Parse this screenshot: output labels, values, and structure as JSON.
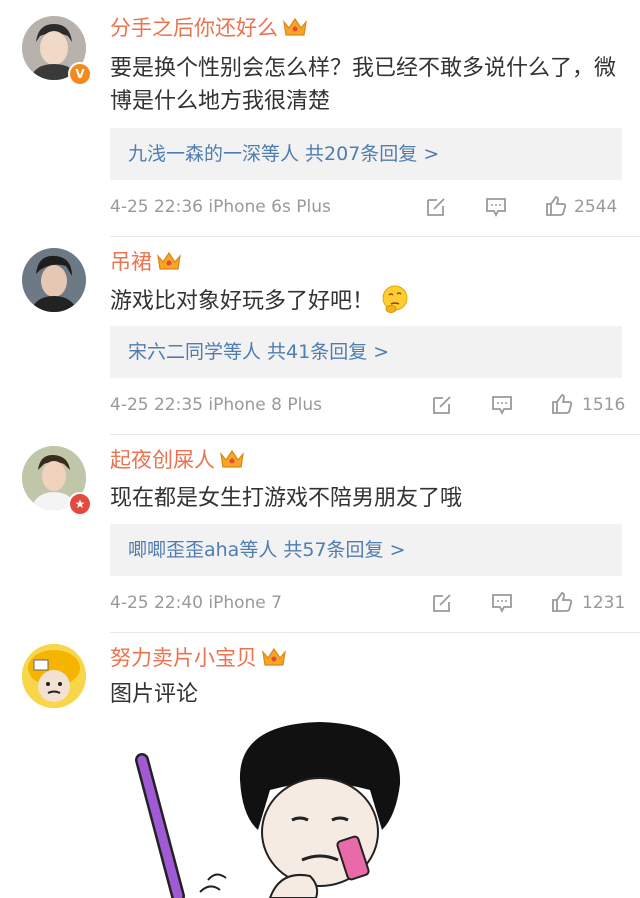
{
  "comments": [
    {
      "username": "分手之后你还好么",
      "text": "要是换个性别会怎么样？我已经不敢多说什么了，微博是什么地方我很清楚",
      "replies": "九浅一森的一深等人 共207条回复 >",
      "meta": "4-25 22:36 iPhone 6s Plus",
      "likes": "2544",
      "badge": "V"
    },
    {
      "username": "吊裙",
      "text": "游戏比对象好玩多了好吧！",
      "replies": "宋六二同学等人 共41条回复 >",
      "meta": "4-25 22:35 iPhone 8 Plus",
      "likes": "1516"
    },
    {
      "username": "起夜创屎人",
      "text": "现在都是女生打游戏不陪男朋友了哦",
      "replies": "唧唧歪歪aha等人 共57条回复 >",
      "meta": "4-25 22:40 iPhone 7",
      "likes": "1231",
      "badge": "★"
    },
    {
      "username": "努力卖片小宝贝",
      "text": "图片评论"
    }
  ],
  "colors": {
    "username": "#eb7350",
    "link": "#507daf",
    "meta": "#999999",
    "reply_bg": "#f2f2f2",
    "crown": "#f5a623"
  },
  "icons": [
    "crown-icon",
    "share-icon",
    "comment-icon",
    "like-icon",
    "thinking-emoji-icon"
  ]
}
